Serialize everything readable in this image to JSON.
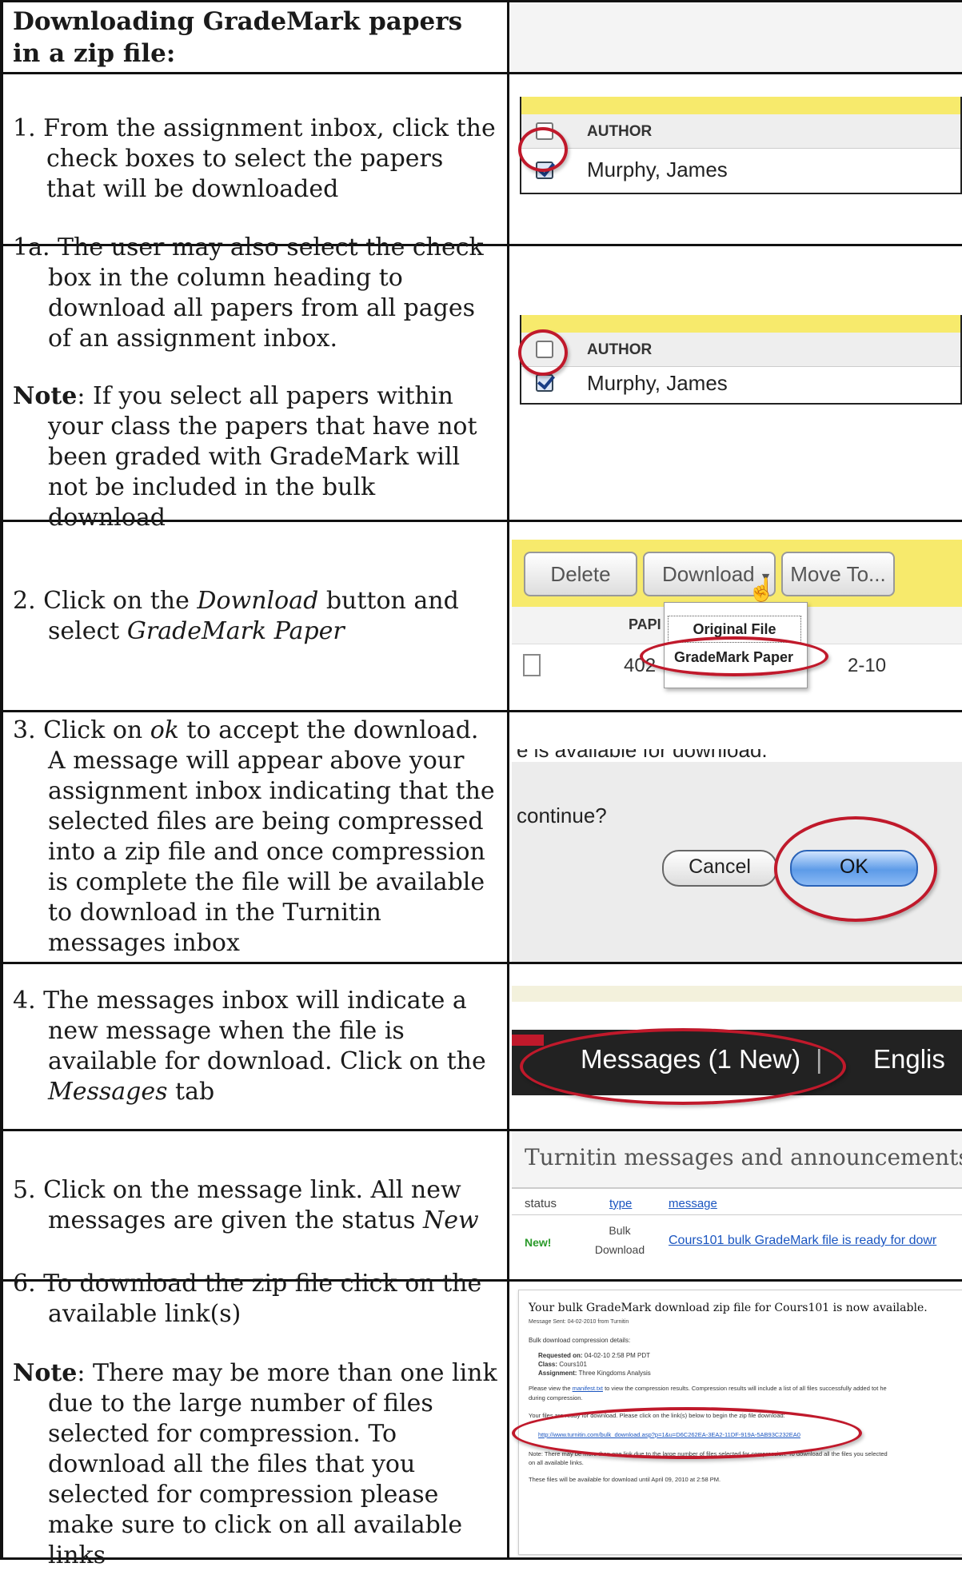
{
  "title": "Downloading GradeMark papers in a zip file:",
  "steps": {
    "s1": "1. From the assignment inbox, click the check boxes to select the papers that will be downloaded",
    "s1a": "1a. The user may also select the check box in the column heading to download all papers from all pages of an assignment inbox.",
    "s1a_note_label": "Note",
    "s1a_note": ": If you select all papers within your class the papers that have not been graded with GradeMark will not be included in the bulk download",
    "s2_a": "2. Click on the ",
    "s2_em1": "Download",
    "s2_b": " button and select ",
    "s2_em2": "GradeMark Paper",
    "s3_a": "3. Click on ",
    "s3_em": "ok",
    "s3_b": " to accept the download. A message will appear above your assignment inbox indicating that the selected files are being compressed into a zip file and once compression is complete the file will be available to download in the Turnitin messages inbox",
    "s4_a": "4. The messages inbox will indicate a new message when the file is available for download. Click on the ",
    "s4_em": "Messages",
    "s4_b": " tab",
    "s5_a": "5. Click on the message link. All new messages are given the status ",
    "s5_em": "New",
    "s6": "6. To download the zip file click on the available link(s)",
    "s6_note_label": "Note",
    "s6_note": ": There may be more than one link due to the large number of files selected for compression. To download all the files that you selected for compression please make sure to click on all available links"
  },
  "shot1": {
    "header": "AUTHOR",
    "name": "Murphy, James"
  },
  "shot2": {
    "header": "AUTHOR",
    "name": "Murphy, James"
  },
  "shot3": {
    "delete": "Delete",
    "download": "Download",
    "moveto": "Move To...",
    "col": "PAPI",
    "num": "402",
    "suffix": "2-10",
    "menu1": "Original File",
    "menu2": "GradeMark Paper"
  },
  "shot4": {
    "top": "e is available for download.",
    "question": "continue?",
    "cancel": "Cancel",
    "ok": "OK"
  },
  "shot5": {
    "tab": "Messages (1 New)",
    "sep": "|",
    "lang": "Englis"
  },
  "shot6": {
    "heading": "Turnitin messages and announcements",
    "h_status": "status",
    "h_type": "type",
    "h_message": "message",
    "new": "New!",
    "type1": "Bulk",
    "type2": "Download",
    "msg": "Cours101 bulk GradeMark file is ready for dowr"
  },
  "shot7": {
    "title": "Your bulk GradeMark download zip file for Cours101 is now available.",
    "sent": "Message Sent: 04-02-2010 from Turnitin",
    "details": "Bulk download compression details:",
    "req_label": "Requested on:",
    "req": "04-02-10 2:58 PM PDT",
    "class_label": "Class:",
    "class": "Cours101",
    "asg_label": "Assignment:",
    "asg": "Three Kingdoms Analysis",
    "view_a": "Please view the ",
    "view_link": "manifest.txt",
    "view_b": " to view the compression results. Compression results will include a list of all files successfully added tot he",
    "view_c": "during compression.",
    "ready": "Your files are ready for download. Please click on the link(s) below to begin the zip file download:",
    "link": "http://www.turnitin.com/bulk_download.asp?p=1&u=D6C262EA-3EA2-11DF-919A-5AB93C232EA0",
    "note": "Note: There may be more than one link due to the large number of files selected for compression. To download all the files you selected",
    "note2": "on all available links.",
    "avail": "These files will be available for download until April 09, 2010 at 2:58 PM."
  }
}
